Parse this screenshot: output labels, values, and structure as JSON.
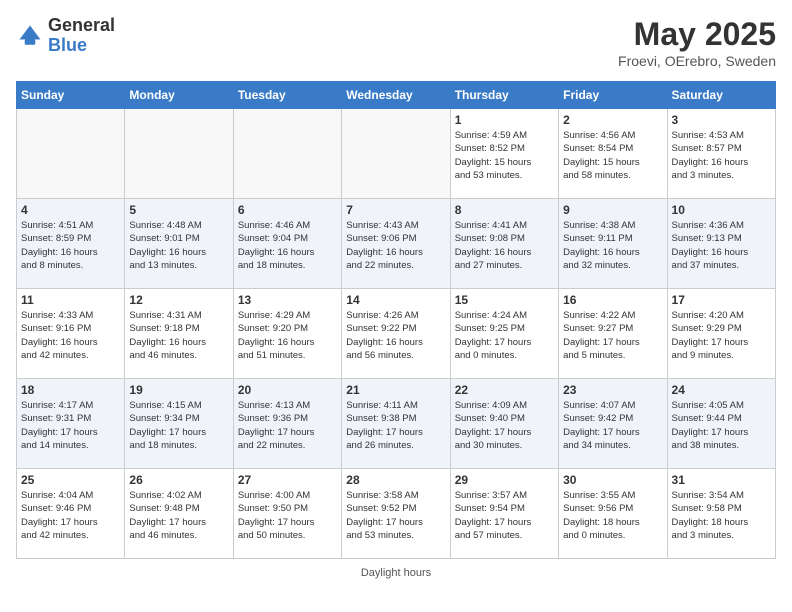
{
  "header": {
    "logo_general": "General",
    "logo_blue": "Blue",
    "title": "May 2025",
    "subtitle": "Froevi, OErebro, Sweden"
  },
  "days_of_week": [
    "Sunday",
    "Monday",
    "Tuesday",
    "Wednesday",
    "Thursday",
    "Friday",
    "Saturday"
  ],
  "weeks": [
    [
      {
        "num": "",
        "info": ""
      },
      {
        "num": "",
        "info": ""
      },
      {
        "num": "",
        "info": ""
      },
      {
        "num": "",
        "info": ""
      },
      {
        "num": "1",
        "info": "Sunrise: 4:59 AM\nSunset: 8:52 PM\nDaylight: 15 hours\nand 53 minutes."
      },
      {
        "num": "2",
        "info": "Sunrise: 4:56 AM\nSunset: 8:54 PM\nDaylight: 15 hours\nand 58 minutes."
      },
      {
        "num": "3",
        "info": "Sunrise: 4:53 AM\nSunset: 8:57 PM\nDaylight: 16 hours\nand 3 minutes."
      }
    ],
    [
      {
        "num": "4",
        "info": "Sunrise: 4:51 AM\nSunset: 8:59 PM\nDaylight: 16 hours\nand 8 minutes."
      },
      {
        "num": "5",
        "info": "Sunrise: 4:48 AM\nSunset: 9:01 PM\nDaylight: 16 hours\nand 13 minutes."
      },
      {
        "num": "6",
        "info": "Sunrise: 4:46 AM\nSunset: 9:04 PM\nDaylight: 16 hours\nand 18 minutes."
      },
      {
        "num": "7",
        "info": "Sunrise: 4:43 AM\nSunset: 9:06 PM\nDaylight: 16 hours\nand 22 minutes."
      },
      {
        "num": "8",
        "info": "Sunrise: 4:41 AM\nSunset: 9:08 PM\nDaylight: 16 hours\nand 27 minutes."
      },
      {
        "num": "9",
        "info": "Sunrise: 4:38 AM\nSunset: 9:11 PM\nDaylight: 16 hours\nand 32 minutes."
      },
      {
        "num": "10",
        "info": "Sunrise: 4:36 AM\nSunset: 9:13 PM\nDaylight: 16 hours\nand 37 minutes."
      }
    ],
    [
      {
        "num": "11",
        "info": "Sunrise: 4:33 AM\nSunset: 9:16 PM\nDaylight: 16 hours\nand 42 minutes."
      },
      {
        "num": "12",
        "info": "Sunrise: 4:31 AM\nSunset: 9:18 PM\nDaylight: 16 hours\nand 46 minutes."
      },
      {
        "num": "13",
        "info": "Sunrise: 4:29 AM\nSunset: 9:20 PM\nDaylight: 16 hours\nand 51 minutes."
      },
      {
        "num": "14",
        "info": "Sunrise: 4:26 AM\nSunset: 9:22 PM\nDaylight: 16 hours\nand 56 minutes."
      },
      {
        "num": "15",
        "info": "Sunrise: 4:24 AM\nSunset: 9:25 PM\nDaylight: 17 hours\nand 0 minutes."
      },
      {
        "num": "16",
        "info": "Sunrise: 4:22 AM\nSunset: 9:27 PM\nDaylight: 17 hours\nand 5 minutes."
      },
      {
        "num": "17",
        "info": "Sunrise: 4:20 AM\nSunset: 9:29 PM\nDaylight: 17 hours\nand 9 minutes."
      }
    ],
    [
      {
        "num": "18",
        "info": "Sunrise: 4:17 AM\nSunset: 9:31 PM\nDaylight: 17 hours\nand 14 minutes."
      },
      {
        "num": "19",
        "info": "Sunrise: 4:15 AM\nSunset: 9:34 PM\nDaylight: 17 hours\nand 18 minutes."
      },
      {
        "num": "20",
        "info": "Sunrise: 4:13 AM\nSunset: 9:36 PM\nDaylight: 17 hours\nand 22 minutes."
      },
      {
        "num": "21",
        "info": "Sunrise: 4:11 AM\nSunset: 9:38 PM\nDaylight: 17 hours\nand 26 minutes."
      },
      {
        "num": "22",
        "info": "Sunrise: 4:09 AM\nSunset: 9:40 PM\nDaylight: 17 hours\nand 30 minutes."
      },
      {
        "num": "23",
        "info": "Sunrise: 4:07 AM\nSunset: 9:42 PM\nDaylight: 17 hours\nand 34 minutes."
      },
      {
        "num": "24",
        "info": "Sunrise: 4:05 AM\nSunset: 9:44 PM\nDaylight: 17 hours\nand 38 minutes."
      }
    ],
    [
      {
        "num": "25",
        "info": "Sunrise: 4:04 AM\nSunset: 9:46 PM\nDaylight: 17 hours\nand 42 minutes."
      },
      {
        "num": "26",
        "info": "Sunrise: 4:02 AM\nSunset: 9:48 PM\nDaylight: 17 hours\nand 46 minutes."
      },
      {
        "num": "27",
        "info": "Sunrise: 4:00 AM\nSunset: 9:50 PM\nDaylight: 17 hours\nand 50 minutes."
      },
      {
        "num": "28",
        "info": "Sunrise: 3:58 AM\nSunset: 9:52 PM\nDaylight: 17 hours\nand 53 minutes."
      },
      {
        "num": "29",
        "info": "Sunrise: 3:57 AM\nSunset: 9:54 PM\nDaylight: 17 hours\nand 57 minutes."
      },
      {
        "num": "30",
        "info": "Sunrise: 3:55 AM\nSunset: 9:56 PM\nDaylight: 18 hours\nand 0 minutes."
      },
      {
        "num": "31",
        "info": "Sunrise: 3:54 AM\nSunset: 9:58 PM\nDaylight: 18 hours\nand 3 minutes."
      }
    ]
  ],
  "footer": {
    "daylight_label": "Daylight hours"
  }
}
